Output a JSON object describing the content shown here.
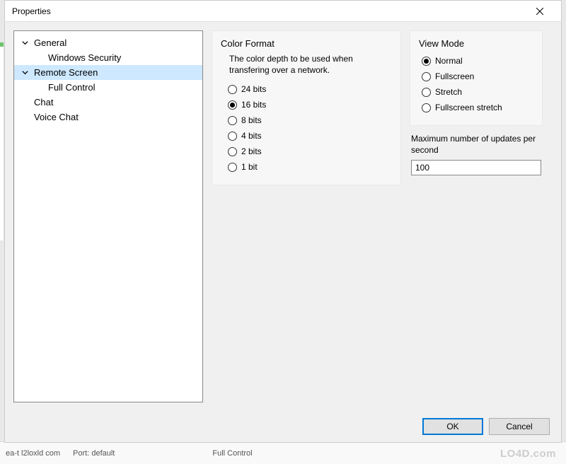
{
  "window": {
    "title": "Properties",
    "close_icon": "close"
  },
  "tree": {
    "items": [
      {
        "label": "General",
        "expander": true,
        "indent": 1,
        "selected": false,
        "interactable": true
      },
      {
        "label": "Windows Security",
        "expander": false,
        "indent": 2,
        "selected": false,
        "interactable": true
      },
      {
        "label": "Remote Screen",
        "expander": true,
        "indent": 1,
        "selected": true,
        "interactable": true
      },
      {
        "label": "Full Control",
        "expander": false,
        "indent": 2,
        "selected": false,
        "interactable": true
      },
      {
        "label": "Chat",
        "expander": false,
        "indent": 1,
        "selected": false,
        "interactable": true
      },
      {
        "label": "Voice Chat",
        "expander": false,
        "indent": 1,
        "selected": false,
        "interactable": true
      }
    ]
  },
  "color_format": {
    "title": "Color Format",
    "description": "The color depth to be used when transfering over a network.",
    "options": [
      {
        "label": "24 bits",
        "checked": false
      },
      {
        "label": "16 bits",
        "checked": true
      },
      {
        "label": "8 bits",
        "checked": false
      },
      {
        "label": "4 bits",
        "checked": false
      },
      {
        "label": "2 bits",
        "checked": false
      },
      {
        "label": "1 bit",
        "checked": false
      }
    ]
  },
  "view_mode": {
    "title": "View Mode",
    "options": [
      {
        "label": "Normal",
        "checked": true
      },
      {
        "label": "Fullscreen",
        "checked": false
      },
      {
        "label": "Stretch",
        "checked": false
      },
      {
        "label": "Fullscreen stretch",
        "checked": false
      }
    ]
  },
  "max_updates": {
    "label": "Maximum number of updates per second",
    "value": "100"
  },
  "buttons": {
    "ok": "OK",
    "cancel": "Cancel"
  },
  "background": {
    "status_left": "ea-t l2loxld com",
    "status_mid": "Port: default",
    "status_right": "Full Control"
  },
  "watermark": "LO4D.com"
}
